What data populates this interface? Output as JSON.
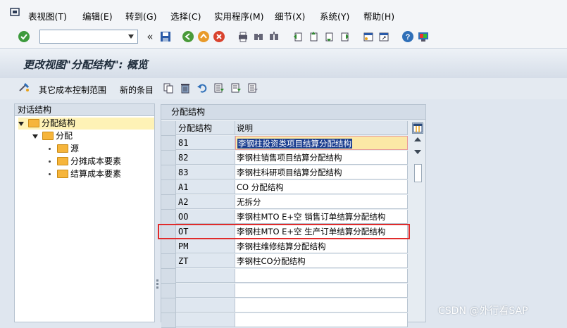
{
  "menu": [
    "表视图(T)",
    "编辑(E)",
    "转到(G)",
    "选择(C)",
    "实用程序(M)",
    "细节(X)",
    "系统(Y)",
    "帮助(H)"
  ],
  "toolbar": {
    "nav_back_glyph": "«"
  },
  "title": "更改视图\"分配结构\": 概览",
  "app_toolbar": {
    "other_area": "其它成本控制范围",
    "new_entries": "新的条目"
  },
  "left_panel": {
    "header": "对话结构",
    "tree": [
      {
        "label": "分配结构",
        "level": 0,
        "expanded": true,
        "selected": true
      },
      {
        "label": "分配",
        "level": 1,
        "expanded": true
      },
      {
        "label": "源",
        "level": 2
      },
      {
        "label": "分摊成本要素",
        "level": 2
      },
      {
        "label": "结算成本要素",
        "level": 2
      }
    ]
  },
  "table": {
    "title": "分配结构",
    "columns": [
      "分配结构",
      "说明"
    ],
    "rows": [
      {
        "code": "81",
        "desc": "李钢柱投资类项目结算分配结构"
      },
      {
        "code": "82",
        "desc": "李钢柱销售项目结算分配结构"
      },
      {
        "code": "83",
        "desc": "李钢柱科研项目结算分配结构"
      },
      {
        "code": "A1",
        "desc": "CO 分配结构"
      },
      {
        "code": "A2",
        "desc": "无拆分"
      },
      {
        "code": "OO",
        "desc": "李钢柱MTO E+空 销售订单结算分配结构"
      },
      {
        "code": "OT",
        "desc": "李钢柱MTO E+空 生产订单结算分配结构"
      },
      {
        "code": "PM",
        "desc": "李钢柱维修结算分配结构"
      },
      {
        "code": "ZT",
        "desc": "李钢柱CO分配结构"
      }
    ],
    "empty_rows": 4,
    "highlighted_row": 6
  },
  "watermark": "CSDN @外行看SAP",
  "colors": {
    "highlight_border": "#e02b2b",
    "selected_tree_bg": "#fef2b6",
    "title_text": "#1d2b3a"
  }
}
